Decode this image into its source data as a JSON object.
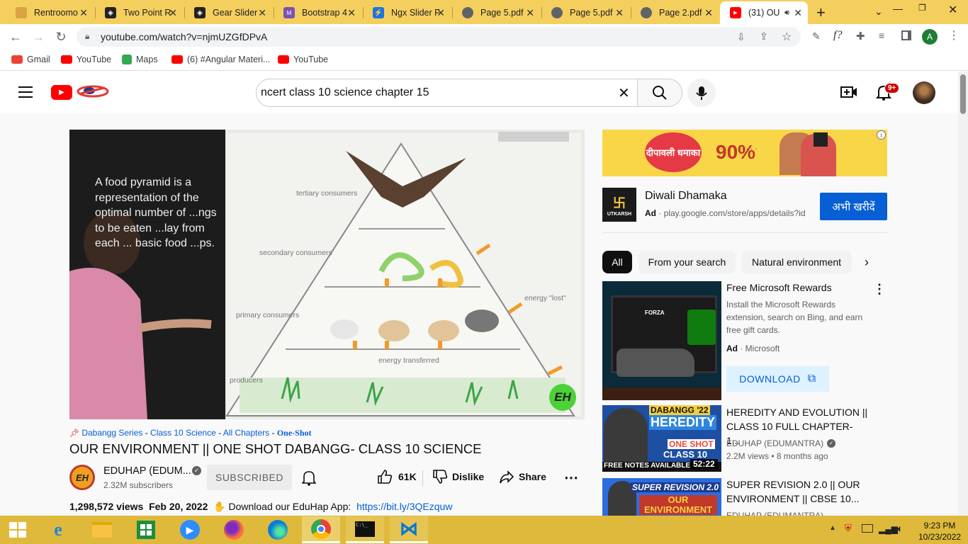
{
  "browser": {
    "tabs": [
      {
        "label": "Rentroomo",
        "color": "#d9a441"
      },
      {
        "label": "Two Point R",
        "color": "#222222"
      },
      {
        "label": "Gear Slider",
        "color": "#222222"
      },
      {
        "label": "Bootstrap 4",
        "color": "#7952b3"
      },
      {
        "label": "Ngx Slider F",
        "color": "#1a73e8"
      },
      {
        "label": "Page 5.pdf",
        "color": "#5f6368"
      },
      {
        "label": "Page 5.pdf",
        "color": "#5f6368"
      },
      {
        "label": "Page 2.pdf",
        "color": "#5f6368"
      },
      {
        "label": "(31) OU",
        "color": "#ff0000"
      }
    ],
    "url": "youtube.com/watch?v=njmUZGfDPvA",
    "profile_initial": "A",
    "bookmarks": [
      {
        "label": "Gmail",
        "color": "#ea4335"
      },
      {
        "label": "YouTube",
        "color": "#ff0000"
      },
      {
        "label": "Maps",
        "color": "#34a853"
      },
      {
        "label": "(6) #Angular Materi...",
        "color": "#ff0000"
      },
      {
        "label": "YouTube",
        "color": "#ff0000"
      }
    ]
  },
  "youtube": {
    "search_query": "ncert class 10 science chapter 15",
    "notification_badge": "9+",
    "video": {
      "overlay_text": "A food pyramid is a representation of the optimal number of ...ngs to be eaten ...lay from each ... basic food ...ps.",
      "levels": [
        "tertiary consumers",
        "secondary consumers",
        "primary consumers",
        "producers"
      ],
      "energy_lost": "energy \"lost\"",
      "energy_transferred": "energy transferred",
      "watermark": "EH",
      "hashtags": [
        "Dabangg Series",
        "Class 10 Science",
        "All Chapters"
      ],
      "hashtag_last": "One-Shot",
      "title": "OUR ENVIRONMENT || ONE SHOT DABANGG- CLASS 10 SCIENCE",
      "channel": "EDUHAP (EDUM...",
      "channel_avatar": "EH",
      "subscribers": "2.32M subscribers",
      "subscribed_label": "SUBSCRIBED",
      "likes": "61K",
      "dislike_label": "Dislike",
      "share_label": "Share",
      "views": "1,298,572 views",
      "date": "Feb 20, 2022",
      "desc_prefix": "Download our EduHap App:",
      "desc_link": "https://bit.ly/3QEzquw"
    },
    "ad": {
      "banner_hindi": "दीपावली धमाका",
      "banner_percent": "90%",
      "title": "Diwali Dhamaka",
      "ad_label": "Ad",
      "url": "play.google.com/store/apps/details?id",
      "cta": "अभी खरीदें",
      "logo_text": "UTKARSH"
    },
    "chips": [
      "All",
      "From your search",
      "Natural environment"
    ],
    "recommendations": [
      {
        "title": "Free Microsoft Rewards",
        "desc": "Install the Microsoft Rewards extension, search on Bing, and earn free gift cards.",
        "ad_label": "Ad",
        "sponsor": "Microsoft",
        "cta": "DOWNLOAD"
      },
      {
        "title": "HEREDITY AND EVOLUTION || CLASS 10 FULL CHAPTER- 1...",
        "channel": "EDUHAP (EDUMANTRA)",
        "meta": "2.2M views • 8 months ago",
        "duration": "52:22",
        "thumb_top": "DABANGG '22",
        "thumb_main": "HEREDITY",
        "thumb_sub": "ONE SHOT",
        "thumb_class": "CLASS 10",
        "thumb_foot": "FREE NOTES AVAILABLE"
      },
      {
        "title": "SUPER REVISION 2.0 || OUR ENVIRONMENT || CBSE 10...",
        "channel": "EDUHAP (EDUMANTRA)",
        "thumb_top": "SUPER REVISION 2.0",
        "thumb_main": "OUR ENVIRONMENT"
      }
    ]
  },
  "taskbar": {
    "time": "9:23 PM",
    "date": "10/23/2022"
  }
}
